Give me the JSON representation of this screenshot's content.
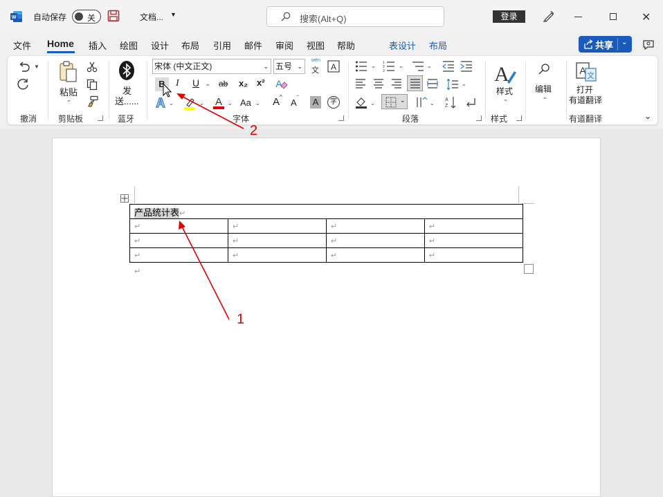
{
  "titlebar": {
    "autosave_label": "自动保存",
    "autosave_state": "关",
    "document_title": "文档...",
    "search_placeholder": "搜索(Alt+Q)",
    "login_label": "登录"
  },
  "menu": {
    "tabs": [
      "文件",
      "Home",
      "插入",
      "绘图",
      "设计",
      "布局",
      "引用",
      "邮件",
      "审阅",
      "视图",
      "帮助",
      "表设计",
      "布局"
    ],
    "active_tab": "Home",
    "share_label": "共享"
  },
  "ribbon": {
    "groups": {
      "undo": "撤消",
      "clipboard": "剪贴板",
      "bluetooth": "蓝牙",
      "font": "字体",
      "paragraph": "段落",
      "styles": "样式",
      "youdao": "有道翻译"
    },
    "paste_label": "粘贴",
    "send_label_1": "发",
    "send_label_2": "送......",
    "font_name": "宋体 (中文正文)",
    "font_size": "五号",
    "phonetic_top": "wén",
    "phonetic_bottom": "文",
    "bold": "B",
    "italic": "I",
    "underline": "U",
    "strike": "ab",
    "subscript": "x₂",
    "superscript": "x²",
    "change_case": "Aa",
    "grow_font": "A",
    "shrink_font": "A",
    "char_shading": "A",
    "enclosed_char": "字",
    "styles_label": "样式",
    "edit_label": "编辑",
    "open_label": "打开",
    "youdao_label": "有道翻译"
  },
  "document": {
    "table_title": "产品统计表",
    "rows": 3,
    "cols": 4,
    "paragraph_mark": "↵"
  },
  "annotations": {
    "label_1": "1",
    "label_2": "2"
  }
}
